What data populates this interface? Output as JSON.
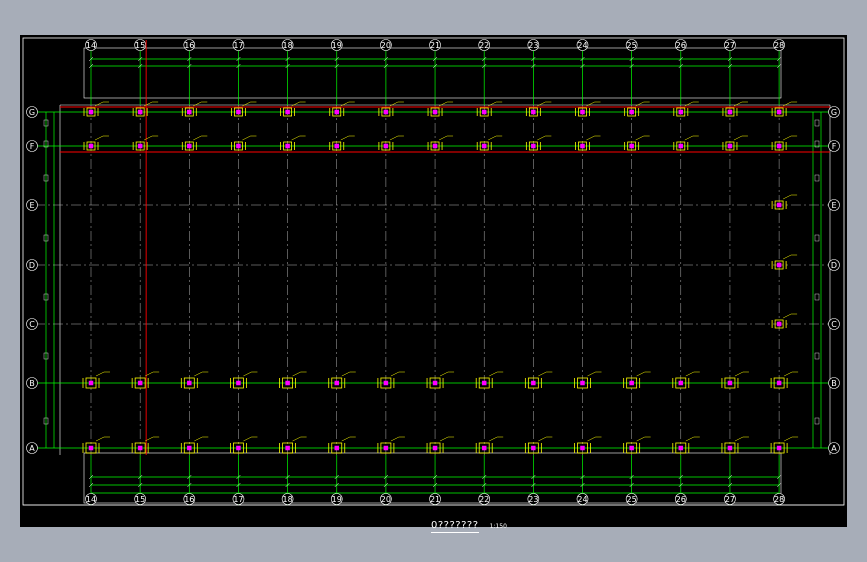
{
  "drawing": {
    "title": "0???????",
    "scale": "1:150",
    "colors": {
      "background": "#000000",
      "frame": "#ffffff",
      "grid_axis": "#00ff00",
      "centerline": "#b4b4b4",
      "highlight": "#ff0000",
      "footing": "#ffff00",
      "column": "#ff00ff"
    },
    "vertical_axes": [
      "14",
      "15",
      "16",
      "17",
      "18",
      "19",
      "20",
      "21",
      "22",
      "23",
      "24",
      "25",
      "26",
      "27",
      "28"
    ],
    "horizontal_axes": [
      "G",
      "F",
      "E",
      "D",
      "C",
      "B",
      "A"
    ],
    "footings": {
      "row_G": [
        "14",
        "15",
        "16",
        "17",
        "18",
        "19",
        "20",
        "21",
        "22",
        "23",
        "24",
        "25",
        "26",
        "27",
        "28"
      ],
      "row_F": [
        "14",
        "15",
        "16",
        "17",
        "18",
        "19",
        "20",
        "21",
        "22",
        "23",
        "24",
        "25",
        "26",
        "27",
        "28"
      ],
      "row_E": [
        "28"
      ],
      "row_D": [
        "28"
      ],
      "row_C": [
        "28"
      ],
      "row_B": [
        "14",
        "15",
        "16",
        "17",
        "18",
        "19",
        "20",
        "21",
        "22",
        "23",
        "24",
        "25",
        "26",
        "27",
        "28"
      ],
      "row_A": [
        "14",
        "15",
        "16",
        "17",
        "18",
        "19",
        "20",
        "21",
        "22",
        "23",
        "24",
        "25",
        "26",
        "27",
        "28"
      ]
    }
  }
}
